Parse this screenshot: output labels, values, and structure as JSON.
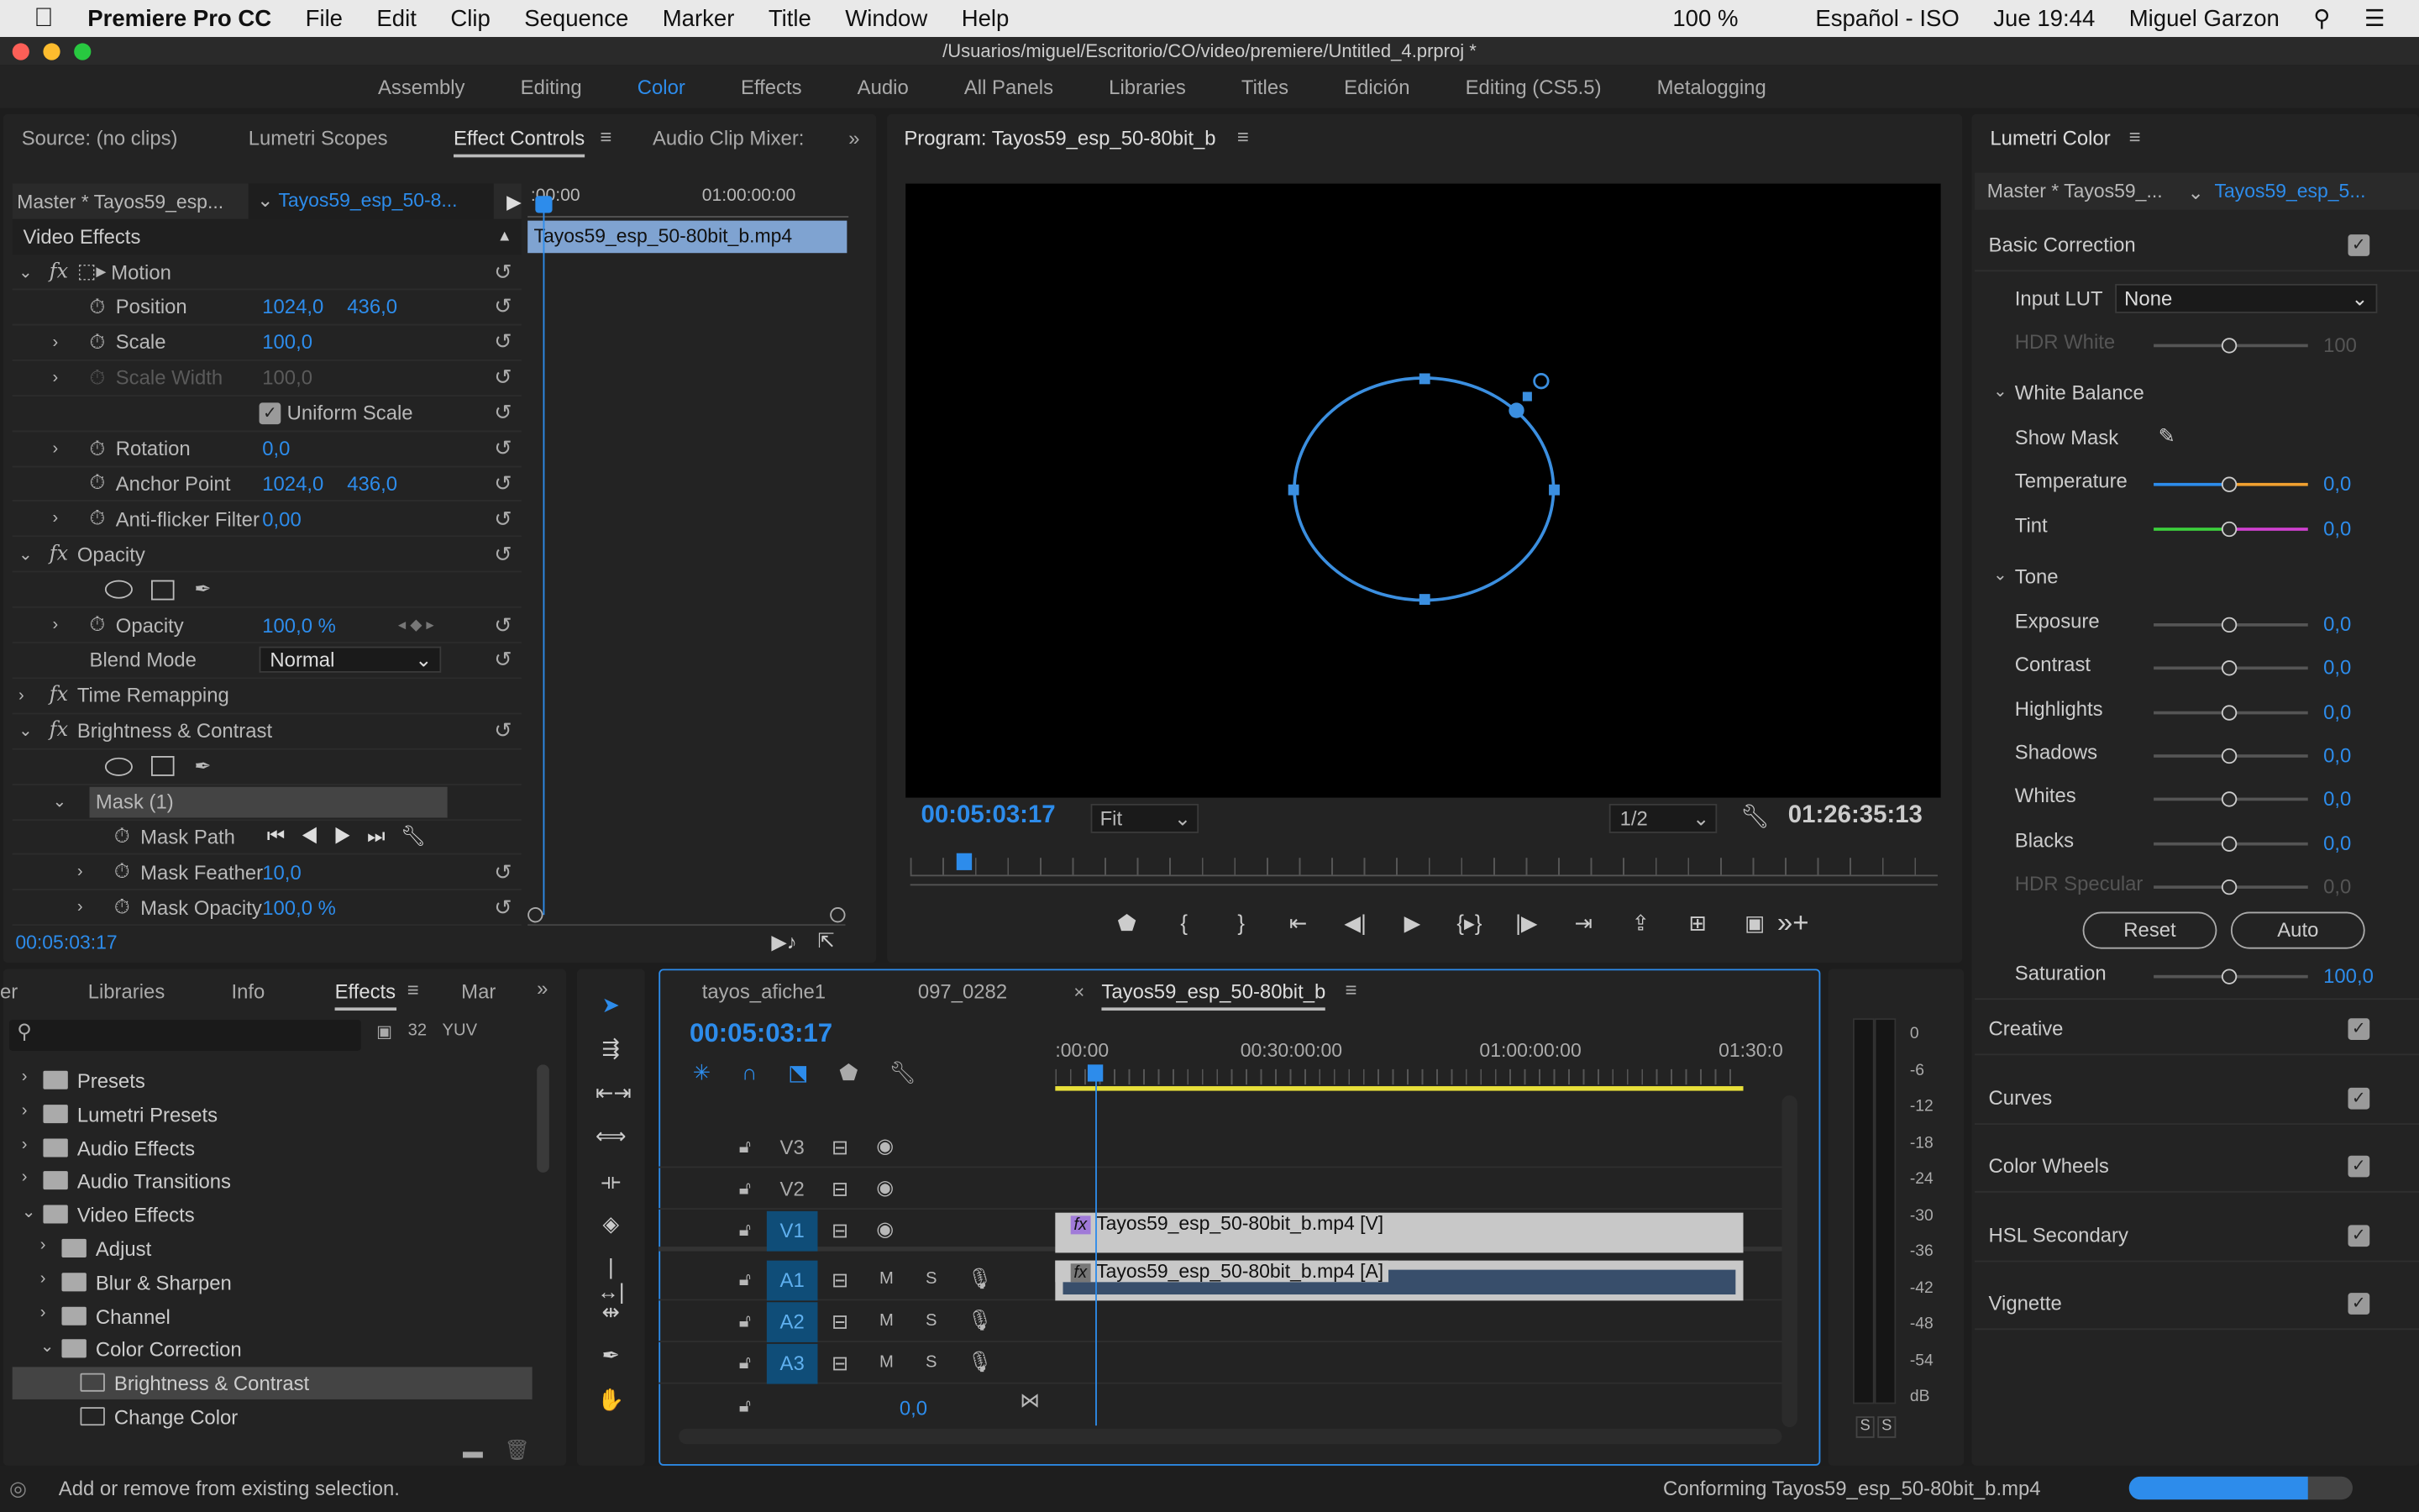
{
  "menubar": {
    "app": "Premiere Pro CC",
    "items": [
      "File",
      "Edit",
      "Clip",
      "Sequence",
      "Marker",
      "Title",
      "Window",
      "Help"
    ],
    "battery": "100 %",
    "language": "Español - ISO",
    "clock": "Jue 19:44",
    "user": "Miguel Garzon"
  },
  "window": {
    "title": "/Usuarios/miguel/Escritorio/CO/video/premiere/Untitled_4.prproj *"
  },
  "workspaces": {
    "items": [
      "Assembly",
      "Editing",
      "Color",
      "Effects",
      "Audio",
      "All Panels",
      "Libraries",
      "Titles",
      "Edición",
      "Editing (CS5.5)",
      "Metalogging"
    ],
    "active": "Color"
  },
  "source_panel": {
    "tabs": [
      "Source: (no clips)",
      "Lumetri Scopes",
      "Effect Controls",
      "Audio Clip Mixer:"
    ],
    "master": "Master * Tayos59_esp...",
    "clip": "Tayos59_esp_50-8...",
    "ruler": [
      ":00:00",
      "01:00:00:00"
    ],
    "clip_bar": "Tayos59_esp_50-80bit_b.mp4",
    "section": "Video Effects",
    "timecode": "00:05:03:17",
    "rows": [
      {
        "indent": 0,
        "arrow": "v",
        "fx": true,
        "label": "Motion",
        "reset": true,
        "icon": "motion"
      },
      {
        "indent": 1,
        "stopwatch": true,
        "label": "Position",
        "v1": "1024,0",
        "v2": "436,0",
        "reset": true
      },
      {
        "indent": 1,
        "arrow": ">",
        "stopwatch": true,
        "label": "Scale",
        "v1": "100,0",
        "reset": true
      },
      {
        "indent": 1,
        "arrow": ">",
        "stopwatch": true,
        "label": "Scale Width",
        "v1": "100,0",
        "reset": true,
        "disabled": true
      },
      {
        "indent": 1,
        "checkbox": true,
        "label": "Uniform Scale",
        "reset": true
      },
      {
        "indent": 1,
        "arrow": ">",
        "stopwatch": true,
        "label": "Rotation",
        "v1": "0,0",
        "reset": true
      },
      {
        "indent": 1,
        "stopwatch": true,
        "label": "Anchor Point",
        "v1": "1024,0",
        "v2": "436,0",
        "reset": true
      },
      {
        "indent": 1,
        "arrow": ">",
        "stopwatch": true,
        "label": "Anti-flicker Filter",
        "v1": "0,00",
        "reset": true
      },
      {
        "indent": 0,
        "arrow": "v",
        "fx": true,
        "label": "Opacity",
        "reset": true
      },
      {
        "indent": 1,
        "masks": true,
        "label": ""
      },
      {
        "indent": 1,
        "arrow": ">",
        "stopwatch": true,
        "label": "Opacity",
        "v1": "100,0 %",
        "reset": true,
        "keyframes": true
      },
      {
        "indent": 1,
        "label": "Blend Mode",
        "select": "Normal",
        "reset": true
      },
      {
        "indent": 0,
        "arrow": ">",
        "fx": true,
        "label": "Time Remapping"
      },
      {
        "indent": 0,
        "arrow": "v",
        "fx": true,
        "label": "Brightness & Contrast",
        "reset": true
      },
      {
        "indent": 1,
        "masks": true,
        "label": ""
      },
      {
        "indent": 1,
        "arrow": "v",
        "label": "Mask (1)",
        "highlight": true
      },
      {
        "indent": 2,
        "stopwatch": true,
        "label": "Mask Path",
        "transport": true
      },
      {
        "indent": 2,
        "arrow": ">",
        "stopwatch": true,
        "label": "Mask Feather",
        "v1": "10,0",
        "reset": true
      },
      {
        "indent": 2,
        "arrow": ">",
        "stopwatch": true,
        "label": "Mask Opacity",
        "v1": "100,0 %",
        "reset": true
      }
    ]
  },
  "program": {
    "title": "Program: Tayos59_esp_50-80bit_b",
    "timecode": "00:05:03:17",
    "fit": "Fit",
    "resolution": "1/2",
    "duration": "01:26:35:13"
  },
  "lumetri": {
    "title": "Lumetri Color",
    "master": "Master * Tayos59_...",
    "clip": "Tayos59_esp_5...",
    "basic": "Basic Correction",
    "input_lut_label": "Input LUT",
    "input_lut": "None",
    "hdr_white": "HDR White",
    "hdr_white_value": "100",
    "white_balance": "White Balance",
    "show_mask": "Show Mask",
    "tone": "Tone",
    "reset": "Reset",
    "auto": "Auto",
    "wb": [
      {
        "label": "Temperature",
        "value": "0,0"
      },
      {
        "label": "Tint",
        "value": "0,0"
      }
    ],
    "tone_sliders": [
      {
        "label": "Exposure",
        "value": "0,0"
      },
      {
        "label": "Contrast",
        "value": "0,0"
      },
      {
        "label": "Highlights",
        "value": "0,0"
      },
      {
        "label": "Shadows",
        "value": "0,0"
      },
      {
        "label": "Whites",
        "value": "0,0"
      },
      {
        "label": "Blacks",
        "value": "0,0"
      },
      {
        "label": "HDR Specular",
        "value": "0,0",
        "disabled": true
      }
    ],
    "saturation": {
      "label": "Saturation",
      "value": "100,0"
    },
    "sections": [
      "Creative",
      "Curves",
      "Color Wheels",
      "HSL Secondary",
      "Vignette"
    ]
  },
  "effects_panel": {
    "tabs": [
      "er",
      "Libraries",
      "Info",
      "Effects",
      "Mar"
    ],
    "active": "Effects",
    "tree": [
      {
        "l": 0,
        "a": ">",
        "label": "Presets",
        "icon": "preset"
      },
      {
        "l": 0,
        "a": ">",
        "label": "Lumetri Presets",
        "icon": "preset"
      },
      {
        "l": 0,
        "a": ">",
        "label": "Audio Effects",
        "icon": "folder"
      },
      {
        "l": 0,
        "a": ">",
        "label": "Audio Transitions",
        "icon": "folder"
      },
      {
        "l": 0,
        "a": "v",
        "label": "Video Effects",
        "icon": "folder"
      },
      {
        "l": 1,
        "a": ">",
        "label": "Adjust",
        "icon": "folder"
      },
      {
        "l": 1,
        "a": ">",
        "label": "Blur & Sharpen",
        "icon": "folder"
      },
      {
        "l": 1,
        "a": ">",
        "label": "Channel",
        "icon": "folder"
      },
      {
        "l": 1,
        "a": "v",
        "label": "Color Correction",
        "icon": "folder"
      },
      {
        "l": 2,
        "a": "",
        "label": "Brightness & Contrast",
        "icon": "effect",
        "selected": true
      },
      {
        "l": 2,
        "a": "",
        "label": "Change Color",
        "icon": "effect"
      }
    ]
  },
  "timeline": {
    "tabs": [
      "tayos_afiche1",
      "097_0282",
      "Tayos59_esp_50-80bit_b"
    ],
    "timecode": "00:05:03:17",
    "ruler": [
      ":00:00",
      "00:30:00:00",
      "01:00:00:00",
      "01:30:0"
    ],
    "tracks": [
      {
        "name": "V3",
        "type": "v"
      },
      {
        "name": "V2",
        "type": "v"
      },
      {
        "name": "V1",
        "type": "v",
        "on": true
      },
      {
        "name": "A1",
        "type": "a",
        "on": true
      },
      {
        "name": "A2",
        "type": "a",
        "on": true
      },
      {
        "name": "A3",
        "type": "a",
        "on": true
      }
    ],
    "video_clip": "Tayos59_esp_50-80bit_b.mp4 [V]",
    "audio_clip": "Tayos59_esp_50-80bit_b.mp4 [A]",
    "master_value": "0,0",
    "mute": "M",
    "solo": "S"
  },
  "meter": {
    "scale": [
      "0",
      "-6",
      "-12",
      "-18",
      "-24",
      "-30",
      "-36",
      "-42",
      "-48",
      "-54",
      "dB"
    ],
    "solo": [
      "S",
      "S"
    ]
  },
  "status": {
    "hint": "Add or remove from existing selection.",
    "progress_text": "Conforming Tayos59_esp_50-80bit_b.mp4",
    "progress": 0.8
  },
  "colors": {
    "accent": "#2d8ceb",
    "mask": "#3b8fe0",
    "work_area": "#e8e03a"
  }
}
